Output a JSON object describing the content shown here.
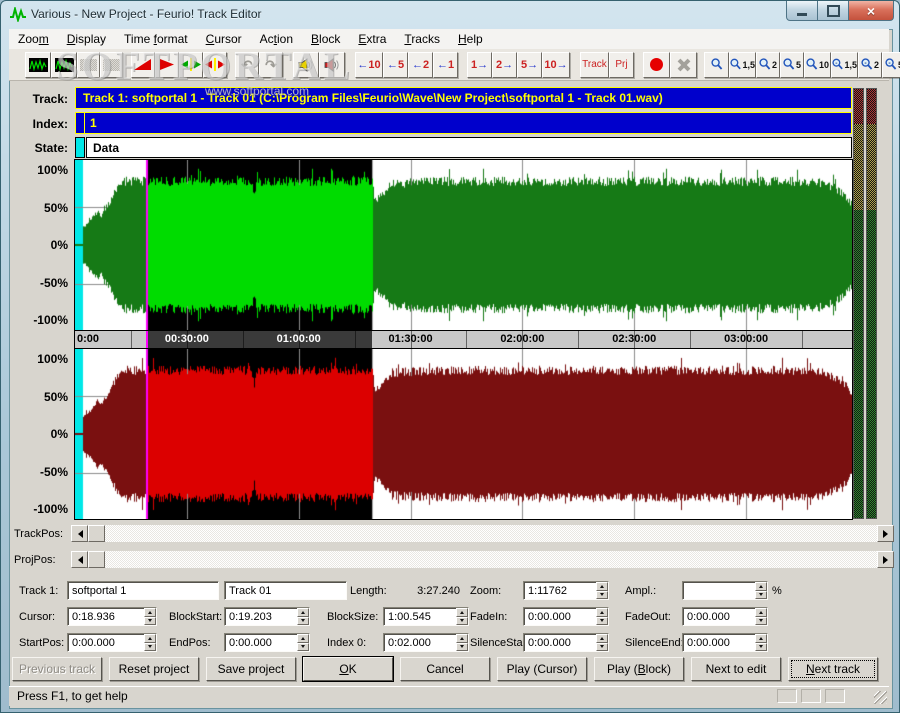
{
  "window": {
    "title": "Various - New Project - Feurio! Track Editor"
  },
  "watermarks": {
    "toolbar": "SOFTPORTAL",
    "corner": "www.softportal.com"
  },
  "menu": {
    "items": [
      {
        "label": "Zoom",
        "u": 3
      },
      {
        "label": "Display",
        "u": 0
      },
      {
        "label": "Time format",
        "u": 5
      },
      {
        "label": "Cursor",
        "u": 0
      },
      {
        "label": "Action",
        "u": 2
      },
      {
        "label": "Block",
        "u": 0
      },
      {
        "label": "Extra",
        "u": 0
      },
      {
        "label": "Tracks",
        "u": 0
      },
      {
        "label": "Help",
        "u": 0
      }
    ]
  },
  "toolbar": {
    "buttons": [
      {
        "name": "track-wave-view",
        "kind": "waveicon",
        "group": 0
      },
      {
        "name": "project-wave-view",
        "kind": "waveicon",
        "group": 0
      },
      {
        "name": "tool-unavailable-1",
        "kind": "dither",
        "group": 0,
        "disabled": true
      },
      {
        "name": "tool-unavailable-2",
        "kind": "dither",
        "group": 0,
        "disabled": true
      },
      {
        "name": "fade-in",
        "kind": "rampup",
        "group": 1
      },
      {
        "name": "fade-out",
        "kind": "playtri",
        "group": 1
      },
      {
        "name": "expand-block",
        "kind": "arrowsout",
        "color": "#00aa00",
        "group": 1
      },
      {
        "name": "shrink-block",
        "kind": "arrowsout",
        "color": "#dd0000",
        "group": 1
      },
      {
        "name": "undo",
        "kind": "char",
        "label": "↶",
        "group": 2,
        "disabled": true
      },
      {
        "name": "redo",
        "kind": "char",
        "label": "↷",
        "group": 2,
        "disabled": true
      },
      {
        "name": "play-speaker",
        "kind": "speaker",
        "color": "#e8d100",
        "group": 3
      },
      {
        "name": "stop-speaker",
        "kind": "speaker",
        "color": "#cc2222",
        "group": 3
      },
      {
        "name": "step-left-10",
        "kind": "stepl",
        "label": "10",
        "group": 4
      },
      {
        "name": "step-left-5",
        "kind": "stepl",
        "label": "5",
        "group": 4
      },
      {
        "name": "step-left-2",
        "kind": "stepl",
        "label": "2",
        "group": 4
      },
      {
        "name": "step-left-1",
        "kind": "stepl",
        "label": "1",
        "group": 4
      },
      {
        "name": "step-right-1",
        "kind": "stepr",
        "label": "1",
        "group": 5
      },
      {
        "name": "step-right-2",
        "kind": "stepr",
        "label": "2",
        "group": 5
      },
      {
        "name": "step-right-5",
        "kind": "stepr",
        "label": "5",
        "group": 5
      },
      {
        "name": "step-right-10",
        "kind": "stepr",
        "label": "10",
        "group": 5
      },
      {
        "name": "goto-track",
        "kind": "rtext",
        "label": "Track",
        "group": 6
      },
      {
        "name": "goto-project",
        "kind": "rtext",
        "label": "Prj",
        "group": 6
      },
      {
        "name": "record",
        "kind": "record",
        "group": 7
      },
      {
        "name": "stop-record",
        "kind": "grayx",
        "group": 7,
        "disabled": true
      },
      {
        "name": "zoom-select",
        "kind": "lens",
        "label": "",
        "group": 8
      },
      {
        "name": "zoom-in-1-5",
        "kind": "lens",
        "label": "1,5",
        "group": 8
      },
      {
        "name": "zoom-in-2",
        "kind": "lens",
        "label": "2",
        "group": 8
      },
      {
        "name": "zoom-in-5",
        "kind": "lens",
        "label": "5",
        "group": 8
      },
      {
        "name": "zoom-in-10",
        "kind": "lens",
        "label": "10",
        "group": 8
      },
      {
        "name": "zoom-out-1-5",
        "kind": "lens",
        "label": "1,5",
        "sign": "-",
        "group": 8
      },
      {
        "name": "zoom-out-2",
        "kind": "lens",
        "label": "2",
        "sign": "-",
        "group": 8
      },
      {
        "name": "zoom-out-5",
        "kind": "lens",
        "label": "5",
        "sign": "-",
        "group": 8
      }
    ]
  },
  "panel": {
    "track_label": "Track:",
    "track_value": "Track 1: softportal 1 - Track 01  (C:\\Program Files\\Feurio\\Wave\\New Project\\softportal 1 - Track 01.wav)",
    "index_label": "Index:",
    "index_value": "1",
    "state_label": "State:",
    "state_value": "Data",
    "percent_labels": [
      "100%",
      "50%",
      "0%",
      "-50%",
      "-100%"
    ]
  },
  "ruler": {
    "labels": [
      {
        "text": "0:00",
        "t": 0
      },
      {
        "text": "00:30:00",
        "t": 30
      },
      {
        "text": "01:00:00",
        "t": 60
      },
      {
        "text": "01:30:00",
        "t": 90
      },
      {
        "text": "02:00:00",
        "t": 120
      },
      {
        "text": "02:30:00",
        "t": 150
      },
      {
        "text": "03:00:00",
        "t": 180
      }
    ]
  },
  "waveform": {
    "duration_s": 208.4,
    "pregap_s": 2.0,
    "block_start_s": 19.203,
    "block_end_s": 79.748,
    "cursor_s": 18.936,
    "selected_bg": "#000000",
    "unselected_bg": "#ffffff",
    "pregap_color": "#00e8e8",
    "cursor_color": "#ff00ff",
    "grid_color": "#8c8c8c",
    "channels": [
      {
        "name": "left",
        "dark": "#167a16",
        "bright": "#00dc00",
        "seed": 1.3
      },
      {
        "name": "right",
        "dark": "#7a1010",
        "bright": "#dc0000",
        "seed": 7.7
      }
    ],
    "envelope": [
      [
        0,
        0.02
      ],
      [
        1.9,
        0.02
      ],
      [
        2.1,
        0.24
      ],
      [
        3,
        0.28
      ],
      [
        4,
        0.32
      ],
      [
        5,
        0.4
      ],
      [
        6,
        0.46
      ],
      [
        7,
        0.4
      ],
      [
        8,
        0.5
      ],
      [
        9,
        0.56
      ],
      [
        10,
        0.66
      ],
      [
        11,
        0.76
      ],
      [
        12.5,
        0.87
      ],
      [
        18,
        0.87
      ],
      [
        47.3,
        0.87
      ],
      [
        48,
        0.68
      ],
      [
        48.7,
        0.87
      ],
      [
        79.7,
        0.87
      ],
      [
        80.4,
        0.6
      ],
      [
        82,
        0.68
      ],
      [
        85,
        0.84
      ],
      [
        100,
        0.87
      ],
      [
        198,
        0.87
      ],
      [
        203,
        0.8
      ],
      [
        206,
        0.7
      ],
      [
        208.4,
        0.55
      ]
    ]
  },
  "meters": {
    "sections": [
      {
        "color": "#b23535",
        "frac": 0.081
      },
      {
        "color": "#b3a24a",
        "frac": 0.202
      },
      {
        "color": "#2d8a2d",
        "frac": 0.717
      }
    ]
  },
  "scrollers": [
    {
      "label": "TrackPos:"
    },
    {
      "label": "ProjPos:"
    }
  ],
  "form": {
    "fields": [
      {
        "id": "track1",
        "label": "Track 1:",
        "value": "softportal 1",
        "spinner": false
      },
      {
        "id": "tracktitle",
        "label": "",
        "value": "Track 01",
        "spinner": false
      },
      {
        "id": "length",
        "label": "Length:",
        "value": "3:27.240",
        "static": true
      },
      {
        "id": "zoom",
        "label": "Zoom:",
        "value": "1:11762",
        "spinner": true
      },
      {
        "id": "ampl",
        "label": "Ampl.:",
        "value": "",
        "spinner": true,
        "suffix": "%"
      },
      {
        "id": "cursor",
        "label": "Cursor:",
        "value": "0:18.936",
        "spinner": true
      },
      {
        "id": "blockstart",
        "label": "BlockStart:",
        "value": "0:19.203",
        "spinner": true
      },
      {
        "id": "blocksize",
        "label": "BlockSize:",
        "value": "1:00.545",
        "spinner": true
      },
      {
        "id": "fadein",
        "label": "FadeIn:",
        "value": "0:00.000",
        "spinner": true
      },
      {
        "id": "fadeout",
        "label": "FadeOut:",
        "value": "0:00.000",
        "spinner": true
      },
      {
        "id": "startpos",
        "label": "StartPos:",
        "value": "0:00.000",
        "spinner": true
      },
      {
        "id": "endpos",
        "label": "EndPos:",
        "value": "0:00.000",
        "spinner": true
      },
      {
        "id": "index0",
        "label": "Index 0:",
        "value": "0:02.000",
        "spinner": true
      },
      {
        "id": "silencestart",
        "label": "SilenceStart",
        "value": "0:00.000",
        "spinner": true
      },
      {
        "id": "silenceend",
        "label": "SilenceEnd:",
        "value": "0:00.000",
        "spinner": true
      }
    ]
  },
  "buttons": [
    {
      "label": "Previous track",
      "disabled": true
    },
    {
      "label": "Reset project"
    },
    {
      "label": "Save project"
    },
    {
      "label": "OK",
      "u": 0,
      "default": true
    },
    {
      "label": "Cancel"
    },
    {
      "label": "Play (Cursor)"
    },
    {
      "label": "Play (Block)",
      "u": 6
    },
    {
      "label": "Next to edit"
    },
    {
      "label": "Next track",
      "u": 0,
      "focused": true
    }
  ],
  "statusbar": {
    "text": "Press F1, to get help"
  }
}
